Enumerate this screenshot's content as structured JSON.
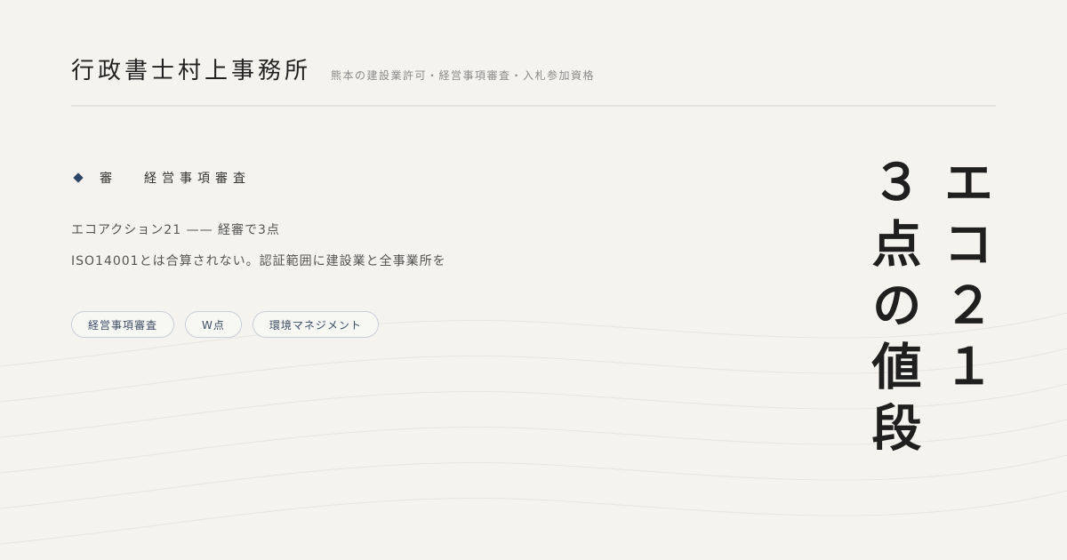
{
  "header": {
    "office_name": "行政書士村上事務所",
    "tagline": "熊本の建設業許可・経営事項審査・入札参加資格"
  },
  "category": {
    "short": "審",
    "full": "経営事項審査"
  },
  "description": {
    "line1": "エコアクション21 —— 経審で3点",
    "line2": "ISO14001とは合算されない。認証範囲に建設業と全事業所を"
  },
  "tags": [
    "経営事項審査",
    "W点",
    "環境マネジメント"
  ],
  "headline": {
    "column1": "エコ２１",
    "column2": "３点の値段"
  },
  "colors": {
    "background": "#f4f3ef",
    "accent": "#2e4466",
    "tag_border": "#c9cfd8"
  }
}
